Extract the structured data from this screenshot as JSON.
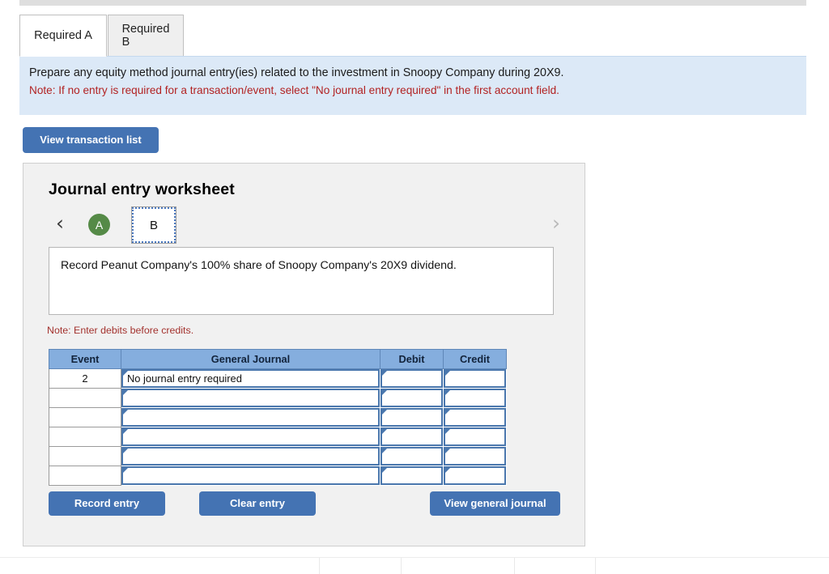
{
  "tabs": [
    {
      "label": "Required A",
      "active": false
    },
    {
      "label": "Required B",
      "active": true
    }
  ],
  "banner": {
    "instruction": "Prepare any equity method journal entry(ies) related to the investment in Snoopy Company during 20X9.",
    "note": "Note: If no entry is required for a transaction/event, select \"No journal entry required\" in the first account field.",
    "bg_color": "#dce9f7",
    "note_color": "#b22222"
  },
  "toolbar": {
    "view_transaction_list_label": "View transaction list"
  },
  "worksheet": {
    "title": "Journal entry worksheet",
    "pager": {
      "prev_icon": "chevron-left-icon",
      "next_icon": "chevron-right-icon",
      "steps": [
        {
          "label": "A",
          "state": "completed",
          "color": "#558a47"
        },
        {
          "label": "B",
          "state": "selected",
          "color": "#ffffff"
        }
      ]
    },
    "description": "Record Peanut Company's 100% share of Snoopy Company's 20X9 dividend.",
    "note_debits": "Note: Enter debits before credits.",
    "table": {
      "headers": [
        "Event",
        "General Journal",
        "Debit",
        "Credit"
      ],
      "header_bg": "#85aede",
      "rows": [
        {
          "event": "2",
          "general_journal": "No journal entry required",
          "debit": "",
          "credit": ""
        },
        {
          "event": "",
          "general_journal": "",
          "debit": "",
          "credit": ""
        },
        {
          "event": "",
          "general_journal": "",
          "debit": "",
          "credit": ""
        },
        {
          "event": "",
          "general_journal": "",
          "debit": "",
          "credit": ""
        },
        {
          "event": "",
          "general_journal": "",
          "debit": "",
          "credit": ""
        },
        {
          "event": "",
          "general_journal": "",
          "debit": "",
          "credit": ""
        }
      ]
    },
    "buttons": {
      "record_entry": "Record entry",
      "clear_entry": "Clear entry",
      "view_general_journal": "View general journal",
      "primary_color": "#4473b3"
    }
  }
}
